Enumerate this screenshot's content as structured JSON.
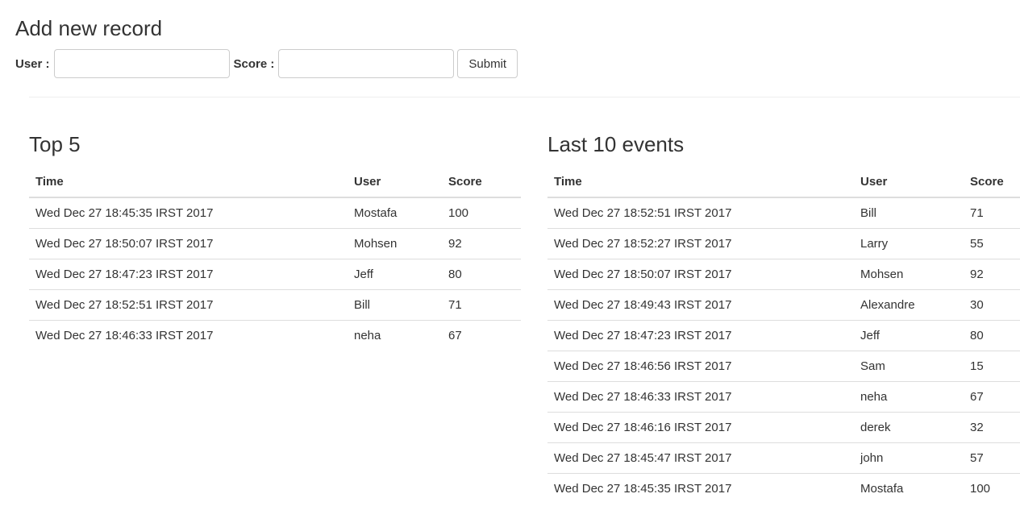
{
  "form": {
    "title": "Add new record",
    "user_label": "User :",
    "user_value": "",
    "score_label": "Score :",
    "score_value": "",
    "submit_label": "Submit"
  },
  "top5": {
    "title": "Top 5",
    "headers": [
      "Time",
      "User",
      "Score"
    ],
    "rows": [
      {
        "time": "Wed Dec 27 18:45:35 IRST 2017",
        "user": "Mostafa",
        "score": "100"
      },
      {
        "time": "Wed Dec 27 18:50:07 IRST 2017",
        "user": "Mohsen",
        "score": "92"
      },
      {
        "time": "Wed Dec 27 18:47:23 IRST 2017",
        "user": "Jeff",
        "score": "80"
      },
      {
        "time": "Wed Dec 27 18:52:51 IRST 2017",
        "user": "Bill",
        "score": "71"
      },
      {
        "time": "Wed Dec 27 18:46:33 IRST 2017",
        "user": "neha",
        "score": "67"
      }
    ]
  },
  "last10": {
    "title": "Last 10 events",
    "headers": [
      "Time",
      "User",
      "Score"
    ],
    "rows": [
      {
        "time": "Wed Dec 27 18:52:51 IRST 2017",
        "user": "Bill",
        "score": "71"
      },
      {
        "time": "Wed Dec 27 18:52:27 IRST 2017",
        "user": "Larry",
        "score": "55"
      },
      {
        "time": "Wed Dec 27 18:50:07 IRST 2017",
        "user": "Mohsen",
        "score": "92"
      },
      {
        "time": "Wed Dec 27 18:49:43 IRST 2017",
        "user": "Alexandre",
        "score": "30"
      },
      {
        "time": "Wed Dec 27 18:47:23 IRST 2017",
        "user": "Jeff",
        "score": "80"
      },
      {
        "time": "Wed Dec 27 18:46:56 IRST 2017",
        "user": "Sam",
        "score": "15"
      },
      {
        "time": "Wed Dec 27 18:46:33 IRST 2017",
        "user": "neha",
        "score": "67"
      },
      {
        "time": "Wed Dec 27 18:46:16 IRST 2017",
        "user": "derek",
        "score": "32"
      },
      {
        "time": "Wed Dec 27 18:45:47 IRST 2017",
        "user": "john",
        "score": "57"
      },
      {
        "time": "Wed Dec 27 18:45:35 IRST 2017",
        "user": "Mostafa",
        "score": "100"
      }
    ]
  }
}
